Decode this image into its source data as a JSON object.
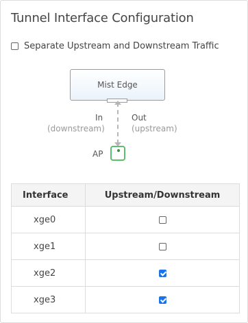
{
  "title": "Tunnel Interface Configuration",
  "separate_traffic": {
    "label": "Separate Upstream and Downstream Traffic",
    "checked": false
  },
  "diagram": {
    "edge_label": "Mist Edge",
    "in_label": "In",
    "in_sub": "(downstream)",
    "out_label": "Out",
    "out_sub": "(upstream)",
    "ap_label": "AP"
  },
  "table": {
    "headers": [
      "Interface",
      "Upstream/Downstream"
    ],
    "rows": [
      {
        "interface": "xge0",
        "checked": false
      },
      {
        "interface": "xge1",
        "checked": false
      },
      {
        "interface": "xge2",
        "checked": true
      },
      {
        "interface": "xge3",
        "checked": true
      }
    ]
  },
  "colors": {
    "accent": "#1a73e8",
    "ap_border": "#5cbf6a"
  }
}
